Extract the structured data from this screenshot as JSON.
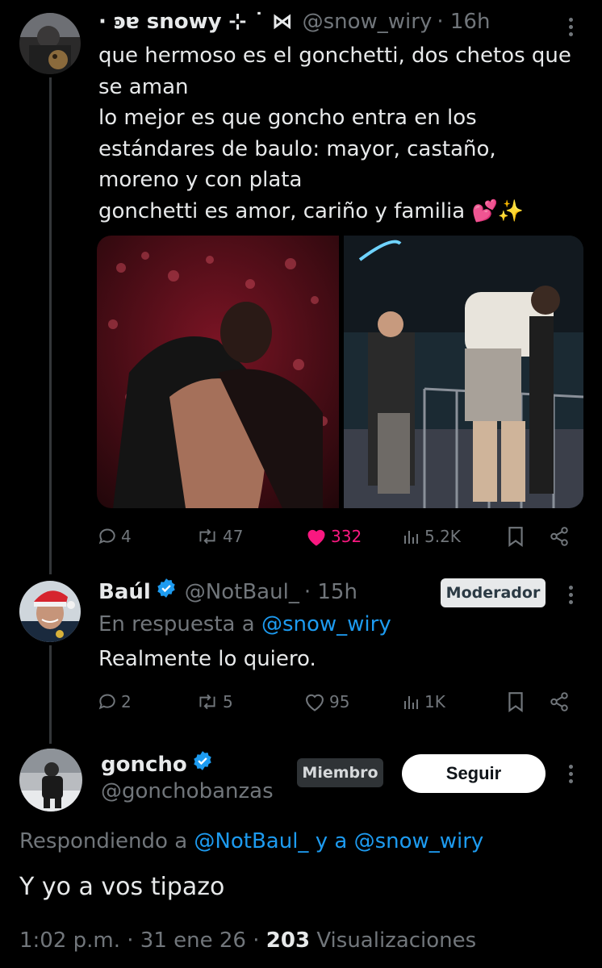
{
  "tweet1": {
    "display_name": "· ͽɐ snowy ⊹ ˙ ⋈",
    "handle": "@snow_wiry",
    "time": "· 16h",
    "lines": [
      "que hermoso es el gonchetti, dos chetos que",
      "se aman",
      "lo mejor es que goncho entra en los",
      "estándares de baulo: mayor, castaño,",
      "moreno y con plata",
      "gonchetti es amor, cariño y familia 💕✨"
    ],
    "actions": {
      "replies": "4",
      "reposts": "47",
      "likes": "332",
      "views": "5.2K"
    }
  },
  "tweet2": {
    "display_name": "Baúl",
    "handle": "@NotBaul_",
    "time": "· 15h",
    "badge": "Moderador",
    "reply_prefix": "En respuesta a",
    "reply_to": "@snow_wiry",
    "text": "Realmente lo quiero.",
    "actions": {
      "replies": "2",
      "reposts": "5",
      "likes": "95",
      "views": "1K"
    }
  },
  "tweet3": {
    "display_name": "goncho",
    "handle": "@gonchobanzas",
    "badge": "Miembro",
    "follow_label": "Seguir",
    "replying_prefix": "Respondiendo a",
    "replying_user1": "@NotBaul_",
    "replying_and": "y a",
    "replying_user2": "@snow_wiry",
    "text": "Y yo a vos tipazo",
    "meta_time": "1:02 p.m. · 31 ene 26 ·",
    "meta_views": "203",
    "meta_views_label": "Visualizaciones"
  },
  "colors": {
    "accent": "#1d9bf0",
    "like": "#f91880",
    "muted": "#71767b",
    "text": "#e7e9ea"
  }
}
